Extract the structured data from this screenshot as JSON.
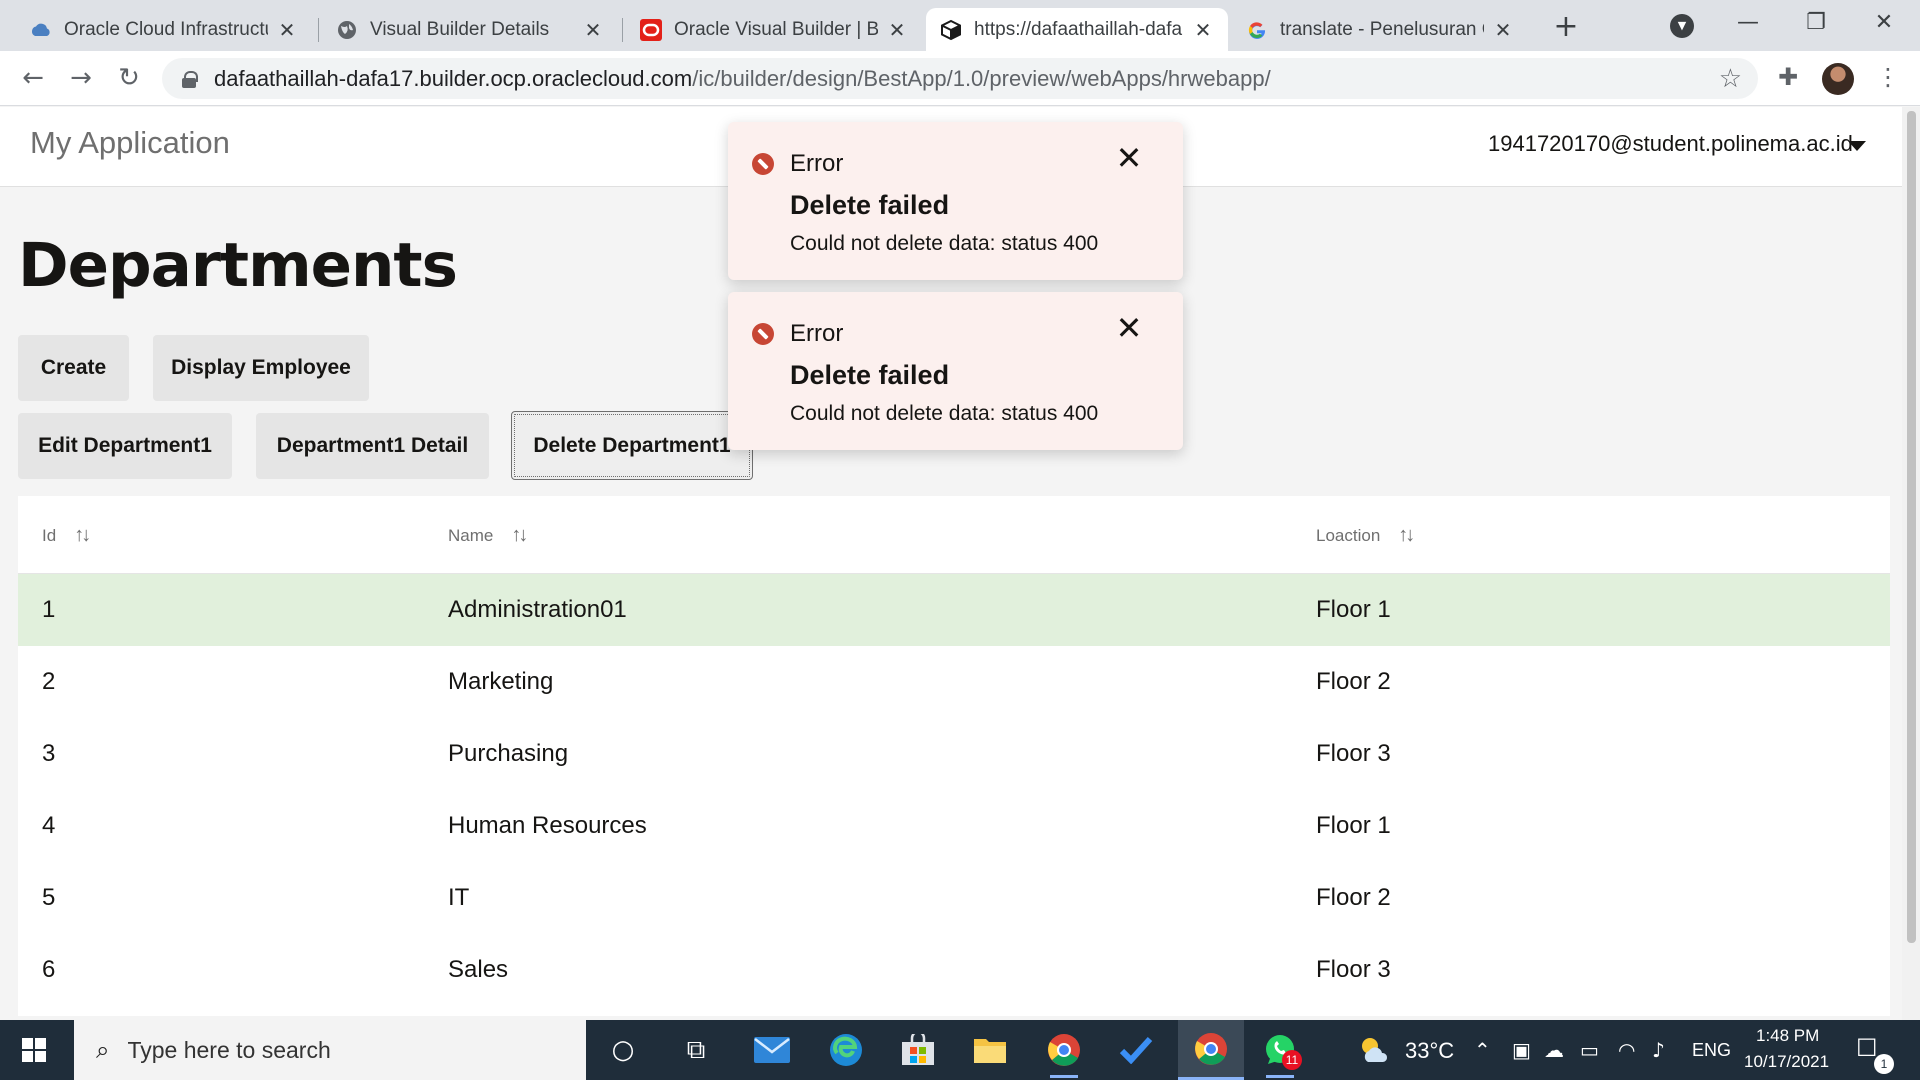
{
  "browser": {
    "tabs": [
      {
        "title": "Oracle Cloud Infrastructure",
        "icon": "cloud-icon",
        "active": false
      },
      {
        "title": "Visual Builder Details",
        "icon": "globe-icon",
        "active": false
      },
      {
        "title": "Oracle Visual Builder | Bes",
        "icon": "oracle-icon",
        "active": false
      },
      {
        "title": "https://dafaathaillah-dafa",
        "icon": "cube-icon",
        "active": true
      },
      {
        "title": "translate - Penelusuran Go",
        "icon": "google-icon",
        "active": false
      }
    ],
    "url_host": "dafaathaillah-dafa17.builder.ocp.oraclecloud.com",
    "url_path": "/ic/builder/design/BestApp/1.0/preview/webApps/hrwebapp/"
  },
  "app": {
    "title": "My Application",
    "user": "1941720170@student.polinema.ac.id"
  },
  "page": {
    "title": "Departments",
    "buttons": {
      "create": "Create",
      "display_employee": "Display Employee",
      "edit": "Edit Department1",
      "detail": "Department1 Detail",
      "delete": "Delete Department1"
    }
  },
  "table": {
    "columns": [
      "Id",
      "Name",
      "Loaction"
    ],
    "rows": [
      {
        "id": "1",
        "name": "Administration01",
        "location": "Floor 1",
        "selected": true
      },
      {
        "id": "2",
        "name": "Marketing",
        "location": "Floor 2",
        "selected": false
      },
      {
        "id": "3",
        "name": "Purchasing",
        "location": "Floor 3",
        "selected": false
      },
      {
        "id": "4",
        "name": "Human Resources",
        "location": "Floor 1",
        "selected": false
      },
      {
        "id": "5",
        "name": "IT",
        "location": "Floor 2",
        "selected": false
      },
      {
        "id": "6",
        "name": "Sales",
        "location": "Floor 3",
        "selected": false
      }
    ]
  },
  "toasts": [
    {
      "label": "Error",
      "summary": "Delete failed",
      "detail": "Could not delete data: status 400"
    },
    {
      "label": "Error",
      "summary": "Delete failed",
      "detail": "Could not delete data: status 400"
    }
  ],
  "taskbar": {
    "search_placeholder": "Type here to search",
    "weather": "33°C",
    "language": "ENG",
    "time": "1:48 PM",
    "date": "10/17/2021",
    "whatsapp_badge": "11",
    "notification_badge": "1"
  },
  "colors": {
    "error_red": "#c74634",
    "toast_bg": "#fcf0ee",
    "selected_row": "#e1f0dc",
    "taskbar": "#1f2d3a"
  }
}
